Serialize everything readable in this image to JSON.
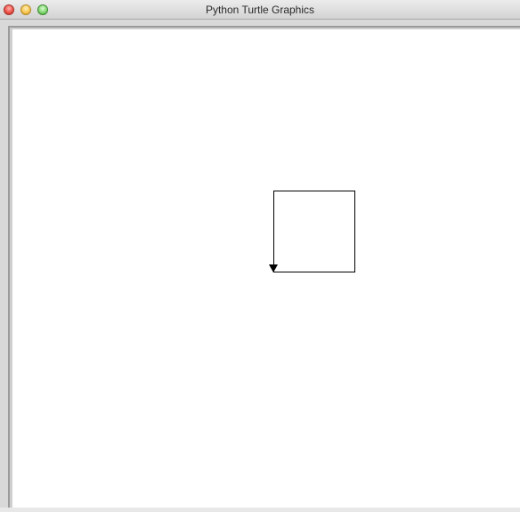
{
  "window": {
    "title": "Python Turtle Graphics"
  },
  "titlebar": {
    "buttons": [
      {
        "name": "close-button",
        "icon": "close-icon",
        "glyph": "×"
      },
      {
        "name": "minimize-button",
        "icon": "minimize-icon",
        "glyph": "−"
      },
      {
        "name": "zoom-button",
        "icon": "zoom-icon",
        "glyph": "+"
      }
    ]
  },
  "canvas": {
    "background": "#ffffff",
    "pen_color": "#000000",
    "shapes": [
      {
        "type": "square",
        "name": "drawn-square"
      }
    ],
    "turtle": {
      "shape": "classic-arrow",
      "heading": "down",
      "icon": "turtle-arrow-icon"
    }
  },
  "colors": {
    "close": "#ec4b42",
    "minimize": "#f5c24a",
    "zoom": "#7bd46b"
  }
}
